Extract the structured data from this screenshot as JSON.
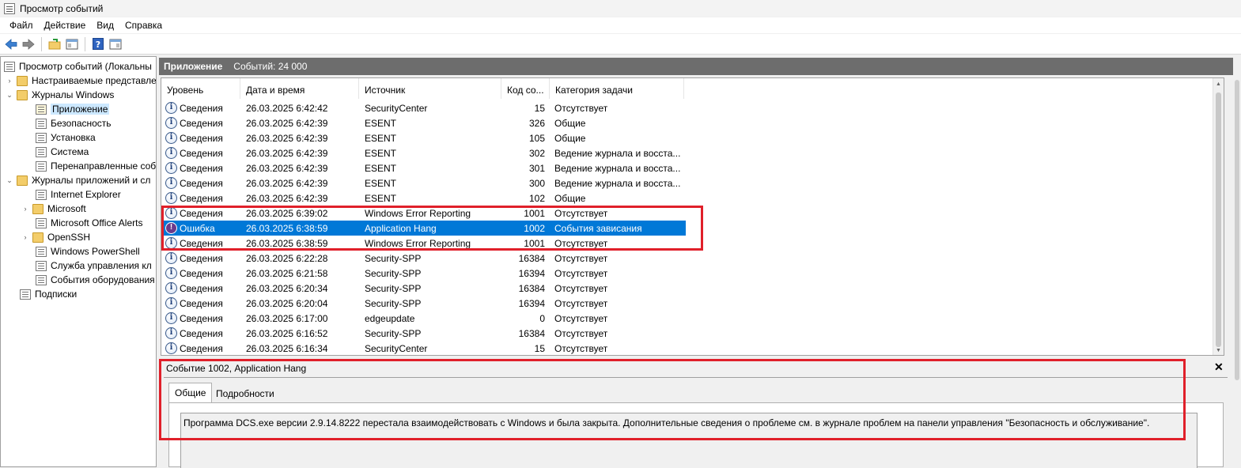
{
  "window": {
    "title": "Просмотр событий"
  },
  "menu": [
    "Файл",
    "Действие",
    "Вид",
    "Справка"
  ],
  "toolbar_icons": [
    "back-icon",
    "forward-icon",
    "open-folder-icon",
    "console-tree-icon",
    "help-icon",
    "action-pane-icon"
  ],
  "tree": [
    {
      "label": "Просмотр событий (Локальны",
      "icon": "event-viewer-icon",
      "arrow": ""
    },
    {
      "label": "Настраиваемые представле",
      "icon": "folder-icon",
      "arrow": "›"
    },
    {
      "label": "Журналы Windows",
      "icon": "folder-icon",
      "arrow": "⌄"
    },
    {
      "label": "Приложение",
      "icon": "log-icon",
      "arrow": ""
    },
    {
      "label": "Безопасность",
      "icon": "log-icon",
      "arrow": ""
    },
    {
      "label": "Установка",
      "icon": "log-icon",
      "arrow": ""
    },
    {
      "label": "Система",
      "icon": "log-icon",
      "arrow": ""
    },
    {
      "label": "Перенаправленные соб",
      "icon": "log-icon",
      "arrow": ""
    },
    {
      "label": "Журналы приложений и сл",
      "icon": "folder-icon",
      "arrow": "⌄"
    },
    {
      "label": "Internet Explorer",
      "icon": "log-icon",
      "arrow": ""
    },
    {
      "label": "Microsoft",
      "icon": "folder-icon",
      "arrow": "›"
    },
    {
      "label": "Microsoft Office Alerts",
      "icon": "log-icon",
      "arrow": ""
    },
    {
      "label": "OpenSSH",
      "icon": "folder-icon",
      "arrow": "›"
    },
    {
      "label": "Windows PowerShell",
      "icon": "log-icon",
      "arrow": ""
    },
    {
      "label": "Служба управления кл",
      "icon": "log-icon",
      "arrow": ""
    },
    {
      "label": "События оборудования",
      "icon": "log-icon",
      "arrow": ""
    },
    {
      "label": "Подписки",
      "icon": "log-icon",
      "arrow": ""
    }
  ],
  "main": {
    "title": "Приложение",
    "count": "Событий: 24 000"
  },
  "columns": [
    "Уровень",
    "Дата и время",
    "Источник",
    "Код со...",
    "Категория задачи"
  ],
  "rows": [
    {
      "level": "Сведения",
      "date": "26.03.2025 6:42:42",
      "source": "SecurityCenter",
      "code": "15",
      "category": "Отсутствует"
    },
    {
      "level": "Сведения",
      "date": "26.03.2025 6:42:39",
      "source": "ESENT",
      "code": "326",
      "category": "Общие"
    },
    {
      "level": "Сведения",
      "date": "26.03.2025 6:42:39",
      "source": "ESENT",
      "code": "105",
      "category": "Общие"
    },
    {
      "level": "Сведения",
      "date": "26.03.2025 6:42:39",
      "source": "ESENT",
      "code": "302",
      "category": "Ведение журнала и восста..."
    },
    {
      "level": "Сведения",
      "date": "26.03.2025 6:42:39",
      "source": "ESENT",
      "code": "301",
      "category": "Ведение журнала и восста..."
    },
    {
      "level": "Сведения",
      "date": "26.03.2025 6:42:39",
      "source": "ESENT",
      "code": "300",
      "category": "Ведение журнала и восста..."
    },
    {
      "level": "Сведения",
      "date": "26.03.2025 6:42:39",
      "source": "ESENT",
      "code": "102",
      "category": "Общие"
    },
    {
      "level": "Сведения",
      "date": "26.03.2025 6:39:02",
      "source": "Windows Error Reporting",
      "code": "1001",
      "category": "Отсутствует"
    },
    {
      "level": "Ошибка",
      "date": "26.03.2025 6:38:59",
      "source": "Application Hang",
      "code": "1002",
      "category": "События зависания"
    },
    {
      "level": "Сведения",
      "date": "26.03.2025 6:38:59",
      "source": "Windows Error Reporting",
      "code": "1001",
      "category": "Отсутствует"
    },
    {
      "level": "Сведения",
      "date": "26.03.2025 6:22:28",
      "source": "Security-SPP",
      "code": "16384",
      "category": "Отсутствует"
    },
    {
      "level": "Сведения",
      "date": "26.03.2025 6:21:58",
      "source": "Security-SPP",
      "code": "16394",
      "category": "Отсутствует"
    },
    {
      "level": "Сведения",
      "date": "26.03.2025 6:20:34",
      "source": "Security-SPP",
      "code": "16384",
      "category": "Отсутствует"
    },
    {
      "level": "Сведения",
      "date": "26.03.2025 6:20:04",
      "source": "Security-SPP",
      "code": "16394",
      "category": "Отсутствует"
    },
    {
      "level": "Сведения",
      "date": "26.03.2025 6:17:00",
      "source": "edgeupdate",
      "code": "0",
      "category": "Отсутствует"
    },
    {
      "level": "Сведения",
      "date": "26.03.2025 6:16:52",
      "source": "Security-SPP",
      "code": "16384",
      "category": "Отсутствует"
    },
    {
      "level": "Сведения",
      "date": "26.03.2025 6:16:34",
      "source": "SecurityCenter",
      "code": "15",
      "category": "Отсутствует"
    }
  ],
  "selected_row": 8,
  "detail": {
    "title": "Событие 1002, Application Hang",
    "close": "✕",
    "tabs": [
      "Общие",
      "Подробности"
    ],
    "message": "Программа DCS.exe версии 2.9.14.8222 перестала взаимодействовать с Windows и была закрыта. Дополнительные сведения о проблеме см. в журнале проблем на панели управления \"Безопасность и обслуживание\"."
  },
  "colors": {
    "selection": "#0078d7",
    "highlight_box": "#e0202a",
    "header": "#6d6d6d"
  }
}
